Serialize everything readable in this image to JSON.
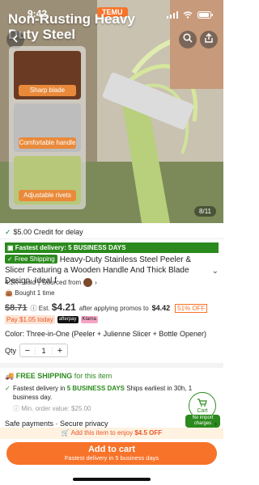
{
  "status_bar": {
    "time": "9:42",
    "brand": "TEMU"
  },
  "hero": {
    "title": "Non-Rusting Heavy Duty Steel",
    "features": [
      {
        "label": "Sharp blade"
      },
      {
        "label": "Comfortable handle"
      },
      {
        "label": "Adjustable rivets"
      }
    ],
    "pager": "8/11"
  },
  "credit": {
    "text": "$5.00 Credit for delay"
  },
  "fast_delivery": {
    "text": "Fastest delivery: 5 BUSINESS DAYS"
  },
  "product": {
    "free_shipping_badge": "Free Shipping",
    "title": "Heavy-Duty Stainless Steel Peeler & Slicer Featuring a Wooden Handle And Thick Blade Design. Ideal f",
    "sold": "4.3K+ sold",
    "sourced_from": "Sourced from",
    "bought": "Bought 1 time"
  },
  "price": {
    "original": "$8.71",
    "est_label": "Est.",
    "est_price": "$4.21",
    "after_text": "after applying promos to",
    "promo_total": "$4.42",
    "discount": "51% OFF",
    "pay_today": "Pay $1.05 today",
    "pay_badges": [
      "afterpay",
      "Klarna"
    ]
  },
  "variant": {
    "text": "Color: Three-in-One (Peeler + Julienne Slicer + Bottle Opener)"
  },
  "quantity": {
    "label": "Qty",
    "value": "1"
  },
  "shipping": {
    "title": "FREE SHIPPING",
    "title_suffix": "for this item",
    "line_prefix": "Fastest delivery in",
    "line_highlight": "5 BUSINESS DAYS",
    "line_suffix": "Ships earliest in 30h, 1 business day.",
    "min_order": "Min. order value: $25.00"
  },
  "cart_widget": {
    "label": "Cart",
    "badge": "No import charges"
  },
  "safe_payments": {
    "text": "Safe payments · Secure privacy"
  },
  "promo_banner": {
    "prefix": "Add this item to enjoy",
    "highlight": "$4.5 OFF"
  },
  "add_to_cart": {
    "label": "Add to cart",
    "sub": "Fastest delivery in 5 business days"
  },
  "colors": {
    "accent": "#f7732a",
    "green": "#2b8a1d"
  }
}
